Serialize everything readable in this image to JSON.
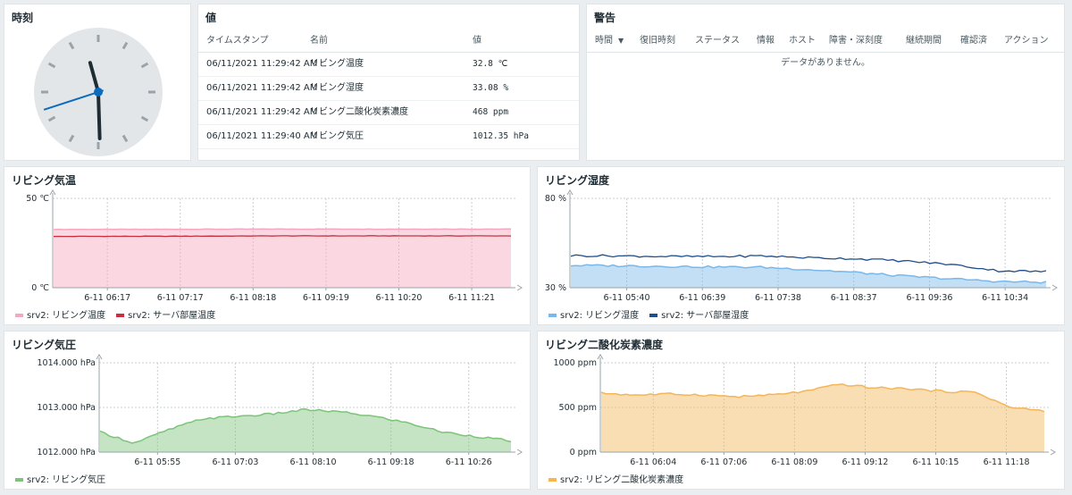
{
  "clock": {
    "title": "時刻",
    "hour": 11,
    "minute": 29,
    "second": 42
  },
  "values": {
    "title": "値",
    "headers": {
      "timestamp": "タイムスタンプ",
      "name": "名前",
      "value": "値"
    },
    "rows": [
      {
        "timestamp": "06/11/2021 11:29:42 AM",
        "name": "リビング温度",
        "value": "32.8 ℃"
      },
      {
        "timestamp": "06/11/2021 11:29:42 AM",
        "name": "リビング湿度",
        "value": "33.08 %"
      },
      {
        "timestamp": "06/11/2021 11:29:42 AM",
        "name": "リビング二酸化炭素濃度",
        "value": "468 ppm"
      },
      {
        "timestamp": "06/11/2021 11:29:40 AM",
        "name": "リビング気圧",
        "value": "1012.35 hPa"
      }
    ]
  },
  "alerts": {
    "title": "警告",
    "headers": [
      "時間",
      "復旧時刻",
      "ステータス",
      "情報",
      "ホスト",
      "障害・深刻度",
      "継続期間",
      "確認済",
      "アクション"
    ],
    "sort_icon": "sort-desc-icon",
    "empty": "データがありません。"
  },
  "chart_data": [
    {
      "type": "area",
      "title": "リビング気温",
      "ylim": [
        0,
        50
      ],
      "yticks": [
        "50 ℃",
        "0 ℃"
      ],
      "xticks": [
        "6-11 06:17",
        "6-11 07:17",
        "6-11 08:18",
        "6-11 09:19",
        "6-11 10:20",
        "6-11 11:21"
      ],
      "series": [
        {
          "name": "srv2: リビング温度",
          "color": "#f7a6bf",
          "values": [
            32.6,
            32.7,
            32.8,
            32.8,
            32.8
          ]
        },
        {
          "name": "srv2: サーバ部屋温度",
          "color": "#c7313f",
          "values": [
            28.7,
            28.8,
            29.0,
            29.0,
            29.0
          ]
        }
      ]
    },
    {
      "type": "area",
      "title": "リビング湿度",
      "ylim": [
        30,
        80
      ],
      "yticks": [
        "80 %",
        "30 %"
      ],
      "xticks": [
        "6-11 05:40",
        "6-11 06:39",
        "6-11 07:38",
        "6-11 08:37",
        "6-11 09:36",
        "6-11 10:34"
      ],
      "series": [
        {
          "name": "srv2: リビング湿度",
          "color": "#7ab8eb",
          "values": [
            42.5,
            42.3,
            42.0,
            41.6,
            41.5,
            40.2,
            38.5,
            36.5,
            35.0,
            33.5,
            33.0
          ]
        },
        {
          "name": "srv2: サーバ部屋湿度",
          "color": "#1f4e8c",
          "values": [
            48.0,
            47.8,
            47.5,
            47.4,
            47.8,
            46.8,
            46.2,
            45.0,
            43.0,
            39.5,
            39.0
          ]
        }
      ]
    },
    {
      "type": "area",
      "title": "リビング気圧",
      "ylim": [
        1012,
        1014
      ],
      "yticks": [
        "1014.000 hPa",
        "1013.000 hPa",
        "1012.000 hPa"
      ],
      "xticks": [
        "6-11 05:55",
        "6-11 07:03",
        "6-11 08:10",
        "6-11 09:18",
        "6-11 10:26"
      ],
      "series": [
        {
          "name": "srv2: リビング気圧",
          "color": "#7cc47a",
          "values": [
            1012.45,
            1012.2,
            1012.5,
            1012.75,
            1012.8,
            1012.85,
            1012.95,
            1012.9,
            1012.8,
            1012.65,
            1012.45,
            1012.35,
            1012.25
          ]
        }
      ]
    },
    {
      "type": "area",
      "title": "リビング二酸化炭素濃度",
      "ylim": [
        0,
        1000
      ],
      "yticks": [
        "1000 ppm",
        "500 ppm",
        "0 ppm"
      ],
      "xticks": [
        "6-11 06:04",
        "6-11 07:06",
        "6-11 08:09",
        "6-11 09:12",
        "6-11 10:15",
        "6-11 11:18"
      ],
      "series": [
        {
          "name": "srv2: リビング二酸化炭素濃度",
          "color": "#f5b556",
          "values": [
            660,
            640,
            650,
            640,
            620,
            640,
            680,
            760,
            720,
            710,
            680,
            670,
            500,
            460
          ]
        }
      ]
    }
  ]
}
